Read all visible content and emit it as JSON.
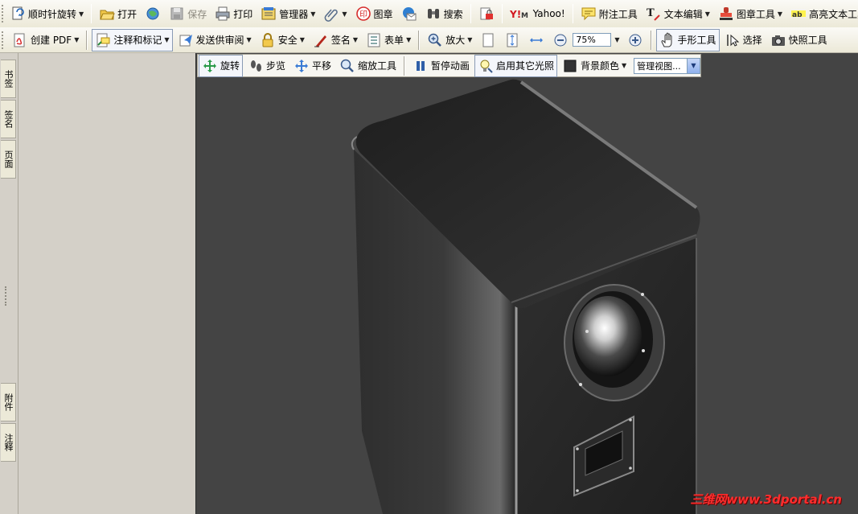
{
  "toolbar1": {
    "rotate_cw_label": "顺时针旋转",
    "open_label": "打开",
    "save_label": "保存",
    "print_label": "打印",
    "organizer_label": "管理器",
    "stamp_label": "图章",
    "search_label": "搜索",
    "yahoo_label": "Yahoo!",
    "sticky_note_label": "附注工具",
    "text_edit_label": "文本编辑",
    "stamp_tool_label": "图章工具",
    "highlight_text_label": "高亮文本工具"
  },
  "toolbar2": {
    "create_pdf_label": "创建 PDF",
    "comment_markup_label": "注释和标记",
    "send_review_label": "发送供审阅",
    "security_label": "安全",
    "sign_label": "签名",
    "forms_label": "表单",
    "zoom_in_label": "放大",
    "zoom_value": "75%",
    "hand_tool_label": "手形工具",
    "select_label": "选择",
    "snapshot_label": "快照工具"
  },
  "left_nav": {
    "bookmarks_label": "书签",
    "signatures_label": "签名",
    "pages_label": "页面",
    "attachments_label": "附件",
    "comments_label": "注释"
  },
  "toolbar3d": {
    "rotate_label": "旋转",
    "walk_label": "步览",
    "pan_label": "平移",
    "zoom_tool_label": "缩放工具",
    "pause_animation_label": "暂停动画",
    "extra_lighting_label": "启用其它光照",
    "background_color_label": "背景颜色",
    "manage_views_label": "管理视图..."
  },
  "watermark": "三维网www.3dportal.cn",
  "colors": {
    "viewport_background": "#444444",
    "speaker_body": "#2b2b2b",
    "watermark": "#ff2d2d",
    "toolbar_bg": "#ece9d8"
  }
}
